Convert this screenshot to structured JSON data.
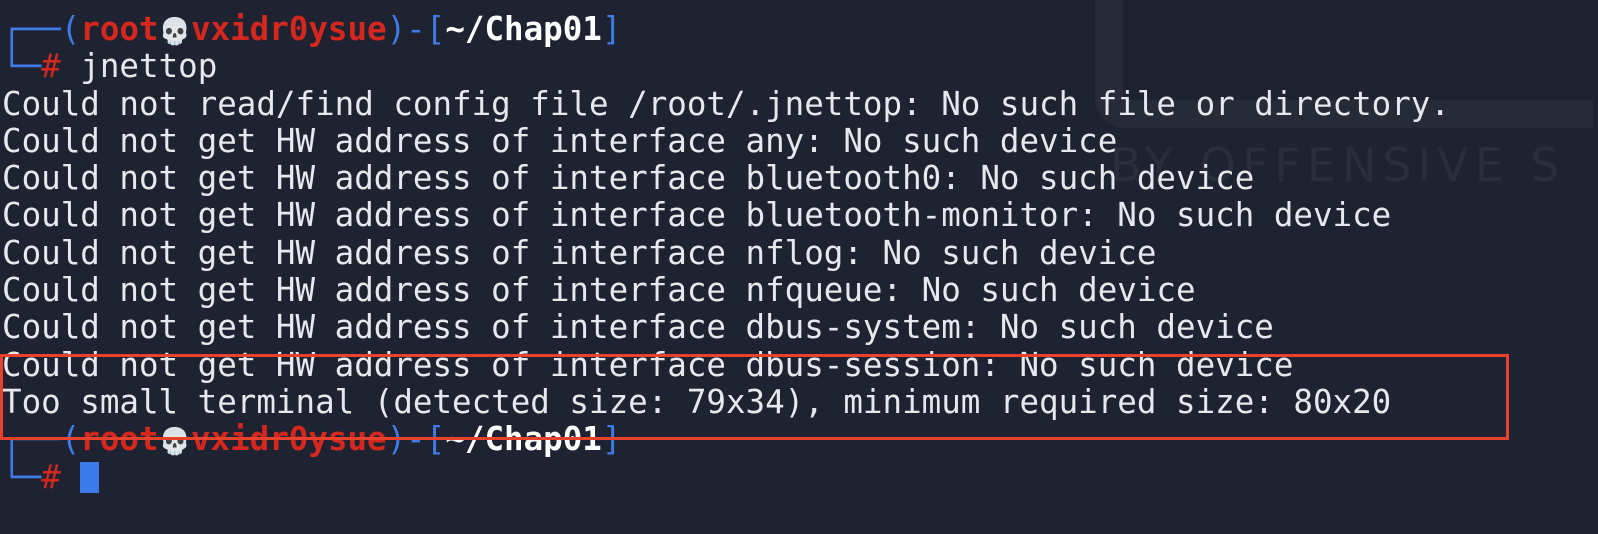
{
  "watermark": "BY OFFENSIVE S",
  "prompt": {
    "open": "┌──(",
    "user": "root",
    "skull": "💀",
    "host": "vxidr0ysue",
    "mid": ")-[",
    "path": "~/Chap01",
    "close": "]",
    "second": "└─",
    "hash": "#"
  },
  "command": "jnettop",
  "output": [
    "Could not read/find config file /root/.jnettop: No such file or directory.",
    "Could not get HW address of interface any: No such device",
    "Could not get HW address of interface bluetooth0: No such device",
    "Could not get HW address of interface bluetooth-monitor: No such device",
    "Could not get HW address of interface nflog: No such device",
    "Could not get HW address of interface nfqueue: No such device",
    "Could not get HW address of interface dbus-system: No such device",
    "Could not get HW address of interface dbus-session: No such device",
    "Too small terminal (detected size: 79x34), minimum required size: 80x20"
  ],
  "colors": {
    "background": "#1f2230",
    "prompt_blue": "#3f7be6",
    "prompt_red": "#d4281f",
    "highlight_box": "#e8412c"
  }
}
